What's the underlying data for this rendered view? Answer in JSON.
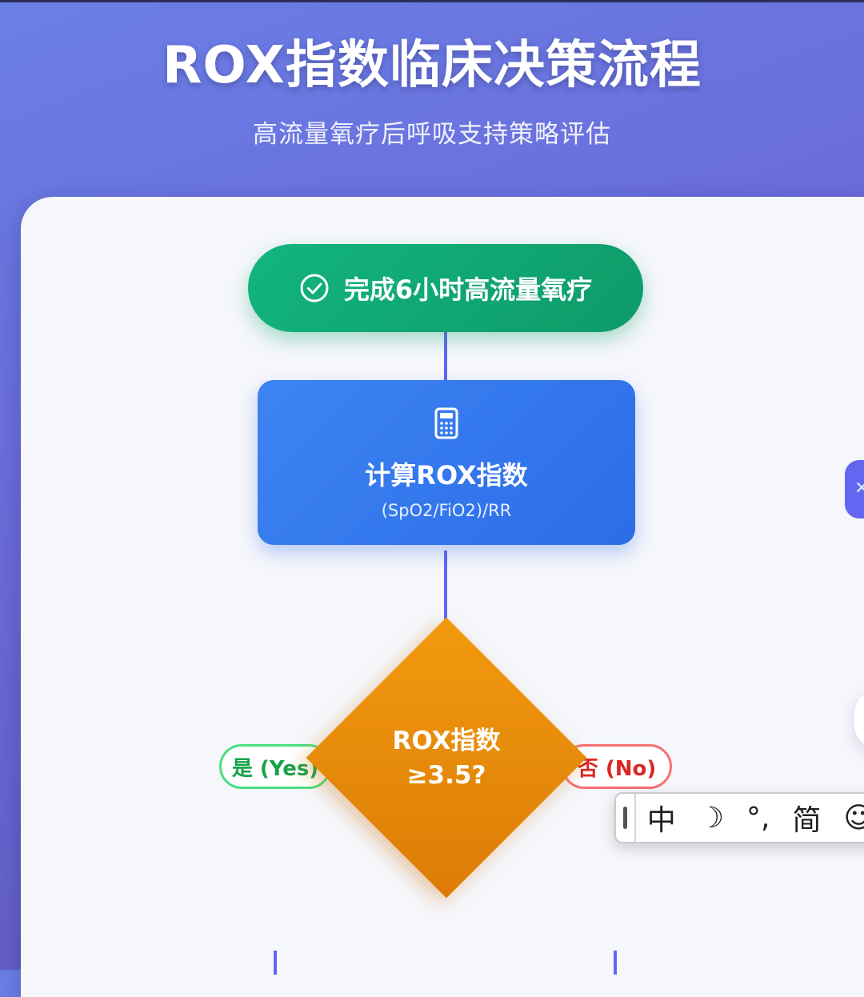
{
  "header": {
    "title": "ROX指数临床决策流程",
    "subtitle": "高流量氧疗后呼吸支持策略评估"
  },
  "flow": {
    "start": {
      "label": "完成6小时高流量氧疗",
      "icon": "check-circle-icon"
    },
    "calc": {
      "title": "计算ROX指数",
      "formula": "(SpO2/FiO2)/RR",
      "icon": "calculator-icon"
    },
    "decision": {
      "line1": "ROX指数",
      "line2": "≥3.5?"
    },
    "branches": {
      "yes": "是 (Yes)",
      "no": "否 (No)"
    }
  },
  "ime": {
    "mode": "中",
    "theme_icon": "moon-icon",
    "punct": "°,",
    "script": "简",
    "emoji_icon": "smiley-icon"
  },
  "colors": {
    "background": "#6a7fe6",
    "connector": "#6366f1",
    "start": "#12b57e",
    "calc": "#3d84f2",
    "decision": "#f29a0f",
    "yes": "#16a34a",
    "no": "#dc2626"
  }
}
